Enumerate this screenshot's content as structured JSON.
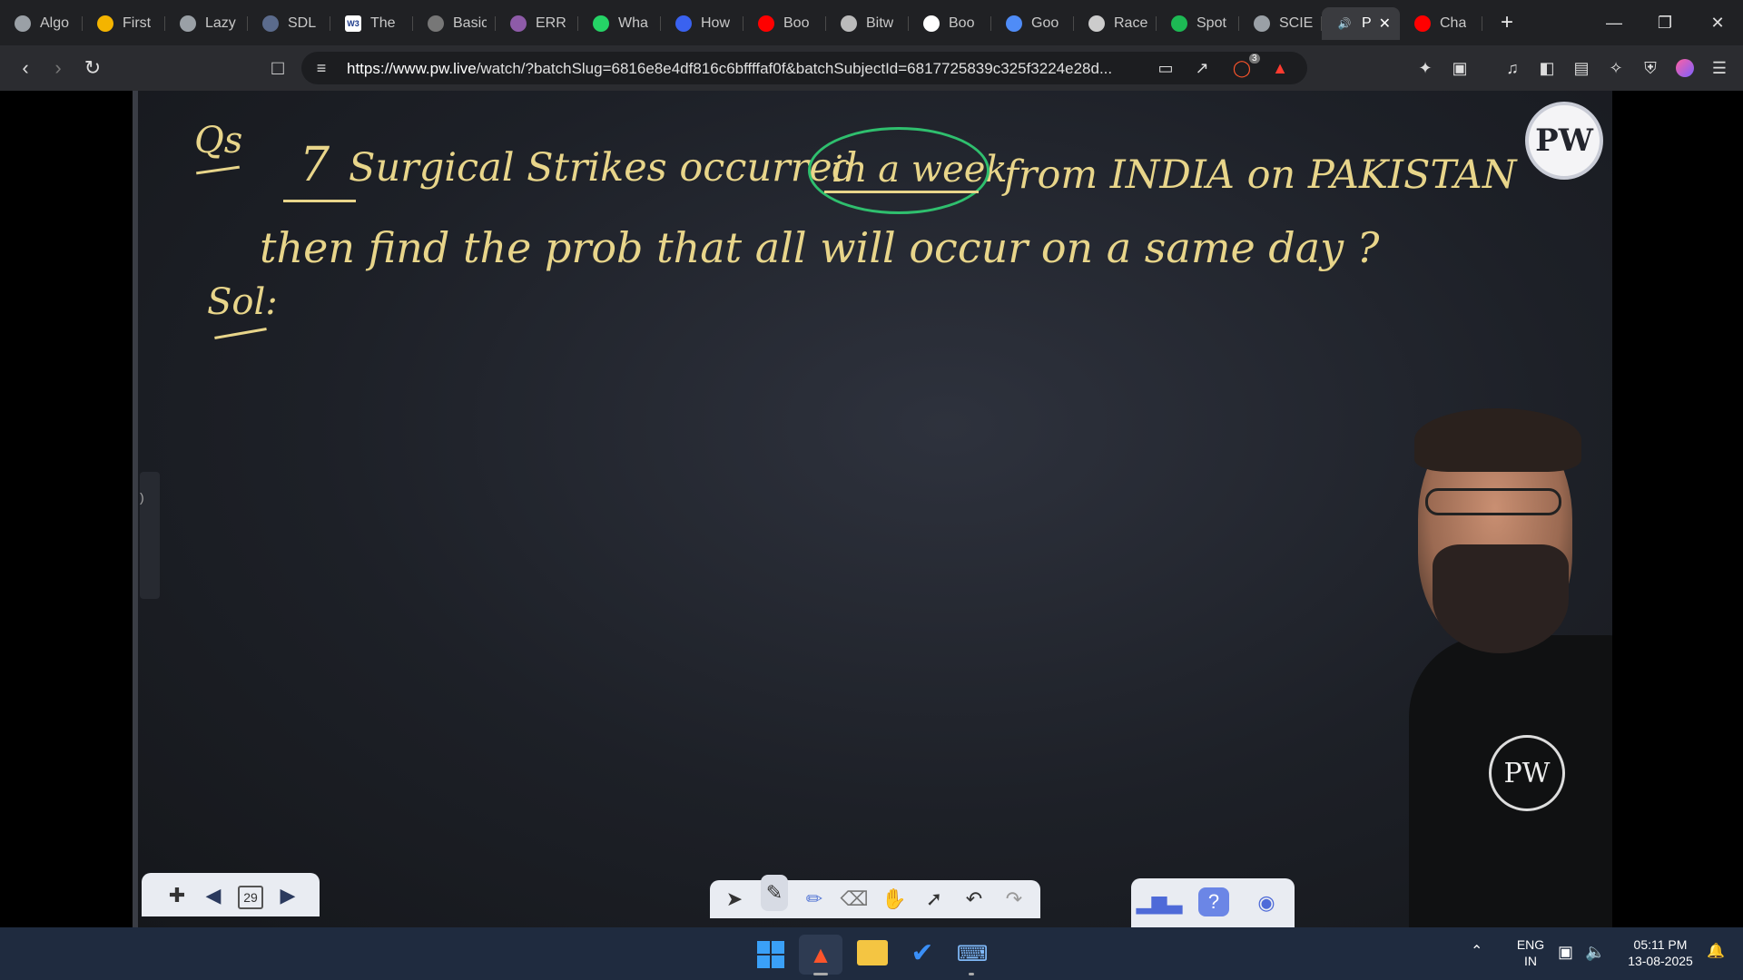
{
  "tabs": [
    {
      "label": "Algo",
      "icon": "globe-icon"
    },
    {
      "label": "First",
      "icon": "bolt-icon"
    },
    {
      "label": "Lazy",
      "icon": "globe-icon"
    },
    {
      "label": "SDL",
      "icon": "sdl-icon"
    },
    {
      "label": "The",
      "icon": "w3-icon"
    },
    {
      "label": "Basic",
      "icon": "mm-icon"
    },
    {
      "label": "ERR",
      "icon": "brain-icon"
    },
    {
      "label": "Wha",
      "icon": "whatsapp-icon"
    },
    {
      "label": "How",
      "icon": "bookmark-icon"
    },
    {
      "label": "Boo",
      "icon": "youtube-icon"
    },
    {
      "label": "Bitw",
      "icon": "orb-icon"
    },
    {
      "label": "Boo",
      "icon": "google-icon"
    },
    {
      "label": "Goo",
      "icon": "gemini-icon"
    },
    {
      "label": "Race",
      "icon": "openai-icon"
    },
    {
      "label": "Spot",
      "icon": "spotify-icon"
    },
    {
      "label": "SCIE",
      "icon": "globe-icon"
    },
    {
      "label": "P",
      "icon": "speaker-icon",
      "active": true
    },
    {
      "label": "Cha",
      "icon": "youtube-icon"
    }
  ],
  "url": {
    "domain": "https://www.pw.live",
    "path": "/watch/?batchSlug=6816e8e4df816c6bffffaf0f&batchSubjectId=6817725839c325f3224e28d..."
  },
  "brave_badge": "3",
  "lecture": {
    "q_label": "Qs",
    "line1_number": "7",
    "line1_a": "Surgical Strikes occurred",
    "line1_circled": "in a week",
    "line1_b": "from INDIA on PAKISTAN",
    "line2": "then find the prob that all will occur on a same day ?",
    "sol_label": "Sol:",
    "page_number": "29",
    "logo_text": "PW"
  },
  "tray": {
    "lang1": "ENG",
    "lang2": "IN",
    "time": "05:11 PM",
    "date": "13-08-2025"
  },
  "colors": {
    "ink": "#e8d58a",
    "circle": "#2fbf6e",
    "taskbar": "#1f2b3f",
    "board": "#1d2027"
  }
}
